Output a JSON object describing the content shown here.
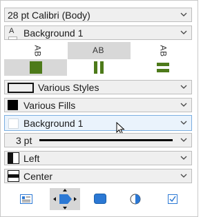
{
  "font": {
    "value": "28 pt Calibri (Body)"
  },
  "text_fill": {
    "icon": "font-color-icon",
    "value": "Background 1",
    "glyph": "A"
  },
  "orientation": {
    "options": [
      {
        "label": "AB",
        "selected": false,
        "name": "vertical-left"
      },
      {
        "label": "AB",
        "selected": true,
        "name": "horizontal"
      },
      {
        "label": "AB",
        "selected": false,
        "name": "vertical-right"
      }
    ],
    "accent": "#4d7a1a"
  },
  "border_style": {
    "value": "Various Styles"
  },
  "fill": {
    "value": "Various Fills"
  },
  "background": {
    "value": "Background 1"
  },
  "line_weight": {
    "value": "3 pt"
  },
  "h_align": {
    "value": "Left"
  },
  "v_align": {
    "value": "Center"
  },
  "toolbar": {
    "buttons": [
      {
        "name": "text-box-button",
        "icon": "text-box-icon",
        "selected": false
      },
      {
        "name": "connector-button",
        "icon": "connector-arrow-icon",
        "selected": true
      },
      {
        "name": "shape-button",
        "icon": "rounded-rectangle-icon",
        "selected": false
      },
      {
        "name": "chart-button",
        "icon": "pie-chart-icon",
        "selected": false
      },
      {
        "name": "checkbox-button",
        "icon": "checkbox-icon",
        "selected": false
      }
    ]
  },
  "colors": {
    "accent_blue": "#2b78d4",
    "highlight": "#eaf3fc",
    "green": "#4d7a1a"
  }
}
